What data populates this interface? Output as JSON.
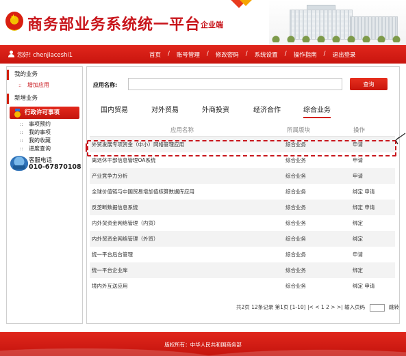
{
  "header": {
    "title": "商务部业务系统统一平台",
    "subtitle": "企业端"
  },
  "navbar": {
    "greeting": "您好! chenjiaceshi1",
    "links": [
      "首页",
      "账号管理",
      "修改密码",
      "系统设置",
      "操作指南",
      "退出登录"
    ],
    "separator": "/"
  },
  "sidebar": {
    "my_business": "我的业务",
    "add_app": "增加应用",
    "new_business": "新增业务",
    "active_item": "行政许可事项",
    "items": [
      "事项预约",
      "我的事项",
      "我的收藏",
      "进度查询"
    ],
    "hotline_label": "客服电话",
    "hotline_number": "010-67870108",
    "bullet": "::"
  },
  "search": {
    "label": "应用名称:",
    "value": "",
    "placeholder": "",
    "button": "查询"
  },
  "tabs": [
    "国内贸易",
    "对外贸易",
    "外商投资",
    "经济合作",
    "综合业务"
  ],
  "active_tab": 4,
  "table": {
    "headers": [
      "应用名称",
      "所属版块",
      "操作"
    ],
    "rows": [
      {
        "name": "外贸发展专项资金（中小）网络管理应用",
        "section": "综合业务",
        "action": "申请"
      },
      {
        "name": "离退休干部信息管理OA系统",
        "section": "综合业务",
        "action": "申请"
      },
      {
        "name": "产业竞争力分析",
        "section": "综合业务",
        "action": "申请"
      },
      {
        "name": "全球价值链与中国贸易增加值核算数据库应用",
        "section": "综合业务",
        "action": "绑定 申请"
      },
      {
        "name": "反垄断数据信息系统",
        "section": "综合业务",
        "action": "绑定 申请"
      },
      {
        "name": "内外贸资金网络管理（内贸）",
        "section": "综合业务",
        "action": "绑定"
      },
      {
        "name": "内外贸资金网络管理（外贸）",
        "section": "综合业务",
        "action": "绑定"
      },
      {
        "name": "统一平台后台管理",
        "section": "综合业务",
        "action": "申请"
      },
      {
        "name": "统一平台企业库",
        "section": "综合业务",
        "action": "绑定"
      },
      {
        "name": "境内外互送应用",
        "section": "综合业务",
        "action": "绑定 申请"
      }
    ]
  },
  "pager": {
    "summary": "共2页 12条记录 第1页 [1-10]",
    "first": "|<",
    "prev": "<",
    "page1": "1",
    "page2": "2",
    "next": ">",
    "last": ">|",
    "input_label": "输入页码",
    "jump": "跳转"
  },
  "footer": {
    "text": "版权所有：中华人民共和国商务部"
  },
  "colors": {
    "brand_red": "#c8151b",
    "nav_red": "#d91f15"
  }
}
